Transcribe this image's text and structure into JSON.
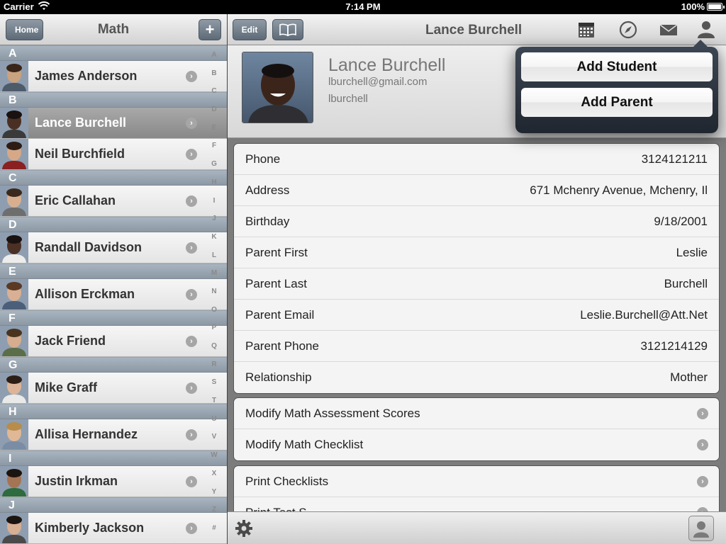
{
  "status_bar": {
    "carrier": "Carrier",
    "time": "7:14 PM",
    "battery": "100%"
  },
  "left_nav": {
    "home_label": "Home",
    "title": "Math",
    "add_label": "+"
  },
  "students": [
    {
      "section": "A",
      "name": "James Anderson",
      "skin": "#c9a27f",
      "hair": "#3a2618",
      "shirt": "#4d5b6b"
    },
    {
      "section": "B",
      "name": "Lance Burchell",
      "skin": "#4a3024",
      "hair": "#1a1210",
      "shirt": "#3a3a3a",
      "selected": true
    },
    {
      "section": "",
      "name": "Neil Burchfield",
      "skin": "#d4a888",
      "hair": "#2c1c14",
      "shirt": "#8a2020"
    },
    {
      "section": "C",
      "name": "Eric Callahan",
      "skin": "#d8b090",
      "hair": "#3b2a1c",
      "shirt": "#6e6e6e"
    },
    {
      "section": "D",
      "name": "Randall Davidson",
      "skin": "#4b3026",
      "hair": "#1a1210",
      "shirt": "#ececec"
    },
    {
      "section": "E",
      "name": "Allison Erckman",
      "skin": "#d9b093",
      "hair": "#5a3a24",
      "shirt": "#4c5f7a"
    },
    {
      "section": "F",
      "name": "Jack Friend",
      "skin": "#d6ad8e",
      "hair": "#4a3420",
      "shirt": "#5b6e4a"
    },
    {
      "section": "G",
      "name": "Mike Graff",
      "skin": "#dcb598",
      "hair": "#2d1e14",
      "shirt": "#e9e9e9"
    },
    {
      "section": "H",
      "name": "Allisa Hernandez",
      "skin": "#e0b896",
      "hair": "#b88c4a",
      "shirt": "#7a8da4"
    },
    {
      "section": "I",
      "name": "Justin Irkman",
      "skin": "#a57454",
      "hair": "#1c1410",
      "shirt": "#2e6b3e"
    },
    {
      "section": "J",
      "name": "Kimberly Jackson",
      "skin": "#d8af92",
      "hair": "#1c1410",
      "shirt": "#4a4a4a"
    }
  ],
  "index_letters": [
    "A",
    "B",
    "C",
    "D",
    "E",
    "F",
    "G",
    "H",
    "I",
    "J",
    "K",
    "L",
    "M",
    "N",
    "O",
    "P",
    "Q",
    "R",
    "S",
    "T",
    "U",
    "V",
    "W",
    "X",
    "Y",
    "Z",
    "#"
  ],
  "right_nav": {
    "edit_label": "Edit",
    "title": "Lance Burchell"
  },
  "profile": {
    "name": "Lance Burchell",
    "email": "lburchell@gmail.com",
    "username": "lburchell"
  },
  "details": [
    {
      "label": "Phone",
      "value": "3124121211"
    },
    {
      "label": "Address",
      "value": "671 Mchenry Avenue, Mchenry, Il"
    },
    {
      "label": "Birthday",
      "value": "9/18/2001"
    },
    {
      "label": "Parent First",
      "value": "Leslie"
    },
    {
      "label": "Parent Last",
      "value": "Burchell"
    },
    {
      "label": "Parent Email",
      "value": "Leslie.Burchell@Att.Net"
    },
    {
      "label": "Parent Phone",
      "value": "3121214129"
    },
    {
      "label": "Relationship",
      "value": "Mother"
    }
  ],
  "actions": [
    {
      "label": "Modify Math Assessment Scores"
    },
    {
      "label": "Modify Math Checklist"
    }
  ],
  "print_actions": [
    {
      "label": "Print Checklists"
    },
    {
      "label": "Print Test S..."
    }
  ],
  "popover": {
    "add_student": "Add Student",
    "add_parent": "Add Parent"
  },
  "icons": {
    "calendar": "calendar-icon",
    "compass": "compass-icon",
    "mail": "mail-icon",
    "person": "person-icon",
    "settings": "gear-icon",
    "book": "book-icon"
  }
}
